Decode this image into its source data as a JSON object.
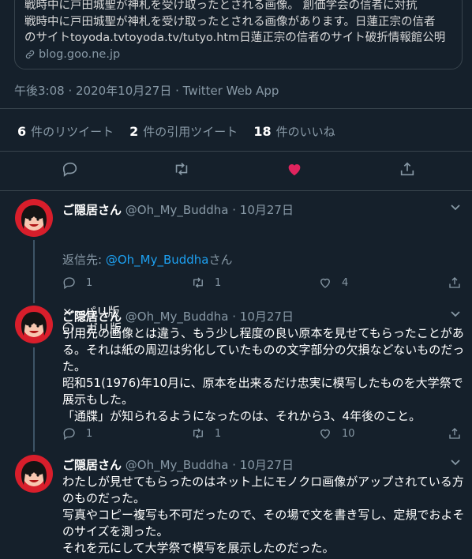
{
  "card": {
    "lines": [
      "戦時中に戸田城聖が神札を受け取ったとされる画像。 創価学会の信者に対抗",
      "戦時中に戸田城聖が神札を受け取ったとされる画像があります。日蓮正宗の信者",
      "のサイトtoyoda.tvtoyoda.tv/tutyo.htm日蓮正宗の信者のサイト破折情報館公明"
    ],
    "domain": "blog.goo.ne.jp"
  },
  "timestamp": "午後3:08 · 2020年10月27日 · Twitter Web App",
  "stats": [
    {
      "count": "6",
      "label": "件のリツイート"
    },
    {
      "count": "2",
      "label": "件の引用ツイート"
    },
    {
      "count": "18",
      "label": "件のいいね"
    }
  ],
  "colors": {
    "bg": "#15202b",
    "divider": "#38444d",
    "muted": "#8899a6",
    "accent": "#1da1f2",
    "like": "#e0245e",
    "avatar": "#d81e2b"
  },
  "icons": [
    "reply-icon",
    "retweet-icon",
    "like-icon-filled",
    "share-icon",
    "chevron-down-icon",
    "link-icon"
  ],
  "tweets": [
    {
      "name": "ご隠居さん",
      "handle_date": "@Oh_My_Buddha · 10月27日",
      "reply_prefix": "返信先: ",
      "reply_handle": "@Oh_My_Buddha",
      "reply_suffix": "さん",
      "text": "×　パリ版\n〇　ガリ版",
      "replies": "1",
      "retweets": "1",
      "likes": "4"
    },
    {
      "name": "ご隠居さん",
      "handle_date": "@Oh_My_Buddha · 10月27日",
      "text": "引用先の画像とは違う、もう少し程度の良い原本を見せてもらったことがある。それは紙の周辺は劣化していたものの文字部分の欠損などないものだった。\n昭和51(1976)年10月に、原本を出来るだけ忠実に模写したものを大学祭で展示もした。\n「通牒」が知られるようになったのは、それから3、4年後のこと。",
      "replies": "1",
      "retweets": "1",
      "likes": "10"
    },
    {
      "name": "ご隠居さん",
      "handle_date": "@Oh_My_Buddha · 10月27日",
      "text": "わたしが見せてもらったのはネット上にモノクロ画像がアップされている方のものだった。\n写真やコピー複写も不可だったので、その場で文を書き写し、定規でおよそのサイズを測った。\nそれを元にして大学祭で模写を展示したのだった。"
    }
  ]
}
